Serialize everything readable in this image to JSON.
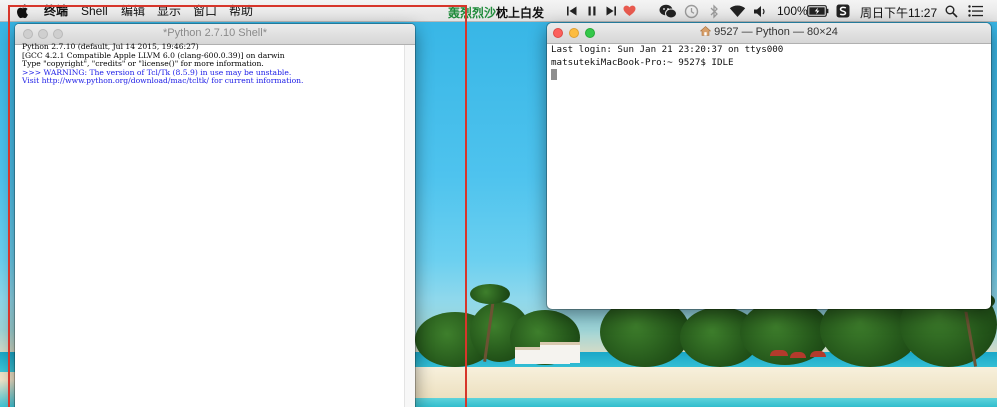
{
  "menubar": {
    "items": [
      "终端",
      "Shell",
      "编辑",
      "显示",
      "窗口",
      "帮助"
    ],
    "lyric_green": "轰烈烈沙",
    "lyric_dark": "枕上白发",
    "battery": "100%",
    "clock": "周日下午11:27"
  },
  "icons": {
    "apple": "apple-icon",
    "media": [
      "previous-track-icon",
      "pause-icon",
      "next-track-icon",
      "heart-icon"
    ],
    "status": [
      "wechat-icon",
      "time-machine-icon",
      "bluetooth-icon",
      "wifi-icon",
      "volume-icon",
      "battery-icon",
      "sogou-input-icon",
      "spotlight-icon",
      "notification-center-icon"
    ]
  },
  "idle_window": {
    "title": "*Python 2.7.10 Shell*",
    "lines": [
      "Python 2.7.10 (default, Jul 14 2015, 19:46:27)",
      "[GCC 4.2.1 Compatible Apple LLVM 6.0 (clang-600.0.39)] on darwin",
      "Type \"copyright\", \"credits\" or \"license()\" for more information."
    ],
    "warning_lines": [
      ">>> WARNING: The version of Tcl/Tk (8.5.9) in use may be unstable.",
      "Visit http://www.python.org/download/mac/tcltk/ for current information."
    ]
  },
  "terminal_window": {
    "title": "9527 — Python — 80×24",
    "lines": [
      "Last login: Sun Jan 21 23:20:37 on ttys000",
      "matsutekiMacBook-Pro:~ 9527$ IDLE"
    ]
  },
  "colors": {
    "annotation": "#d7362b",
    "close": "#fc605c",
    "minimize": "#fdbc40",
    "zoom": "#34c84a",
    "lyric": "#1e8b3a"
  }
}
